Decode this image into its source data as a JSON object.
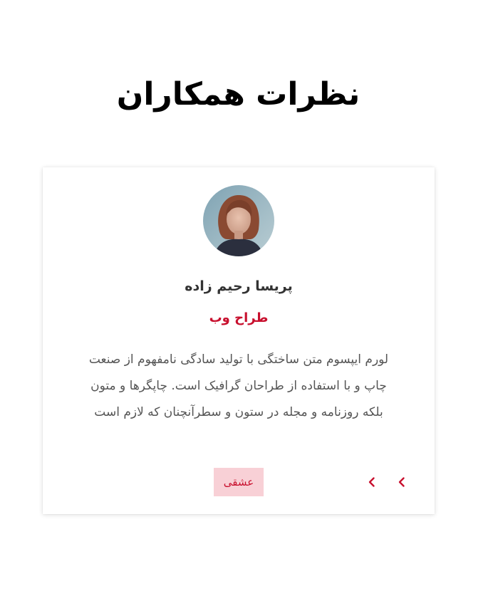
{
  "section": {
    "title": "نظرات همکاران"
  },
  "testimonial": {
    "name": "پریسا رحیم زاده",
    "role": "طراح وب",
    "text_lines": [
      "لورم ایپسوم متن ساختگی با تولید سادگی نامفهوم از صنعت",
      "چاپ و با استفاده از طراحان گرافیک است. چاپگرها و متون",
      "بلکه روزنامه و مجله در ستون و سطرآنچنان که لازم است"
    ],
    "tag_label": "عشقی"
  },
  "icons": {
    "next": "chevron-left-icon",
    "prev": "chevron-left-icon",
    "avatar": "user-photo"
  },
  "colors": {
    "accent": "#c8102e",
    "tag_background": "#f8d0d6",
    "title": "#000000",
    "text": "#555555"
  }
}
